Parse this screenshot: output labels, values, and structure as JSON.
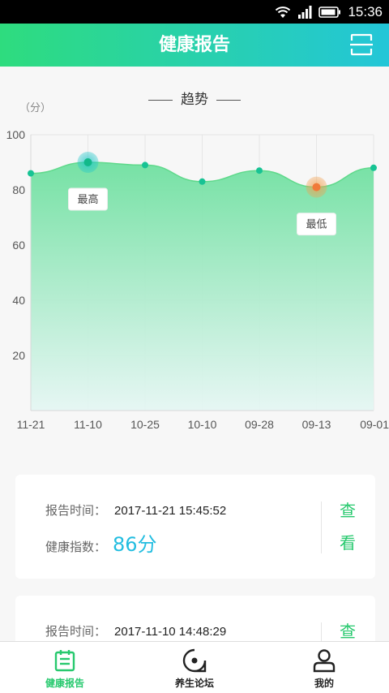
{
  "status_bar": {
    "time": "15:36"
  },
  "header": {
    "title": "健康报告"
  },
  "trend": {
    "title": "趋势",
    "unit": "（分）"
  },
  "chart_data": {
    "type": "area",
    "x": [
      "11-21",
      "11-10",
      "10-25",
      "10-10",
      "09-28",
      "09-13",
      "09-01"
    ],
    "values": [
      86,
      90,
      89,
      83,
      87,
      81,
      88
    ],
    "ylim": [
      0,
      100
    ],
    "yticks": [
      20,
      40,
      60,
      80,
      100
    ],
    "grid": true,
    "annotations": [
      {
        "label": "最高",
        "index": 1
      },
      {
        "label": "最低",
        "index": 5
      }
    ]
  },
  "reports": [
    {
      "time_label": "报告时间：",
      "time": "2017-11-21 15:45:52",
      "score_label": "健康指数：",
      "score": "86分",
      "view_label_1": "查",
      "view_label_2": "看"
    },
    {
      "time_label": "报告时间：",
      "time": "2017-11-10 14:48:29",
      "view_label_1": "查"
    }
  ],
  "tabs": [
    {
      "label": "健康报告",
      "active": true
    },
    {
      "label": "养生论坛",
      "active": false
    },
    {
      "label": "我的",
      "active": false
    }
  ],
  "colors": {
    "accent": "#27c96e",
    "score": "#22bde0",
    "high": "#1fc6c9",
    "low": "#f2a050"
  }
}
